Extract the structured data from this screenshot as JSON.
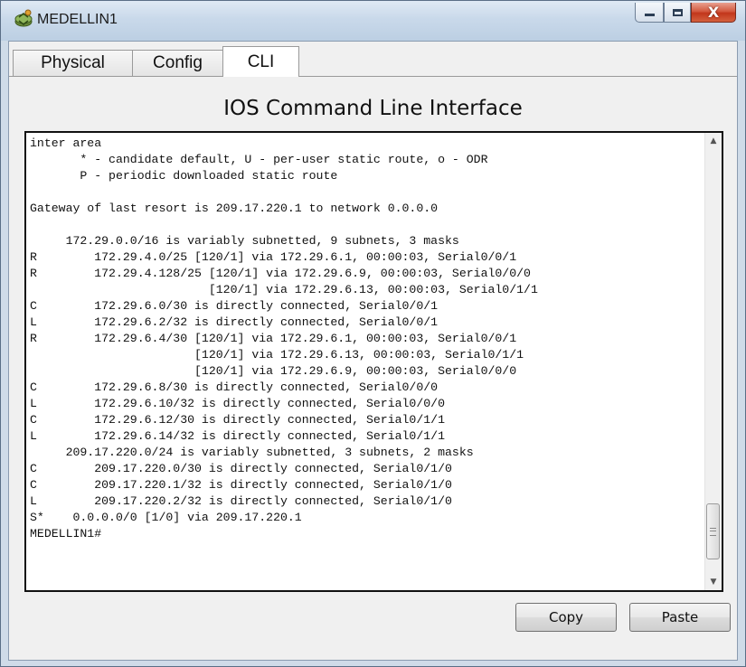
{
  "window": {
    "title": "MEDELLIN1",
    "icon": "router-icon",
    "close_label": "X"
  },
  "tabs": [
    {
      "label": "Physical",
      "active": false
    },
    {
      "label": "Config",
      "active": false
    },
    {
      "label": "CLI",
      "active": true
    }
  ],
  "cli": {
    "heading": "IOS Command Line Interface",
    "output_lines": [
      "inter area",
      "       * - candidate default, U - per-user static route, o - ODR",
      "       P - periodic downloaded static route",
      "",
      "Gateway of last resort is 209.17.220.1 to network 0.0.0.0",
      "",
      "     172.29.0.0/16 is variably subnetted, 9 subnets, 3 masks",
      "R        172.29.4.0/25 [120/1] via 172.29.6.1, 00:00:03, Serial0/0/1",
      "R        172.29.4.128/25 [120/1] via 172.29.6.9, 00:00:03, Serial0/0/0",
      "                         [120/1] via 172.29.6.13, 00:00:03, Serial0/1/1",
      "C        172.29.6.0/30 is directly connected, Serial0/0/1",
      "L        172.29.6.2/32 is directly connected, Serial0/0/1",
      "R        172.29.6.4/30 [120/1] via 172.29.6.1, 00:00:03, Serial0/0/1",
      "                       [120/1] via 172.29.6.13, 00:00:03, Serial0/1/1",
      "                       [120/1] via 172.29.6.9, 00:00:03, Serial0/0/0",
      "C        172.29.6.8/30 is directly connected, Serial0/0/0",
      "L        172.29.6.10/32 is directly connected, Serial0/0/0",
      "C        172.29.6.12/30 is directly connected, Serial0/1/1",
      "L        172.29.6.14/32 is directly connected, Serial0/1/1",
      "     209.17.220.0/24 is variably subnetted, 3 subnets, 2 masks",
      "C        209.17.220.0/30 is directly connected, Serial0/1/0",
      "C        209.17.220.1/32 is directly connected, Serial0/1/0",
      "L        209.17.220.2/32 is directly connected, Serial0/1/0",
      "S*    0.0.0.0/0 [1/0] via 209.17.220.1",
      "MEDELLIN1#"
    ]
  },
  "buttons": {
    "copy": "Copy",
    "paste": "Paste"
  }
}
